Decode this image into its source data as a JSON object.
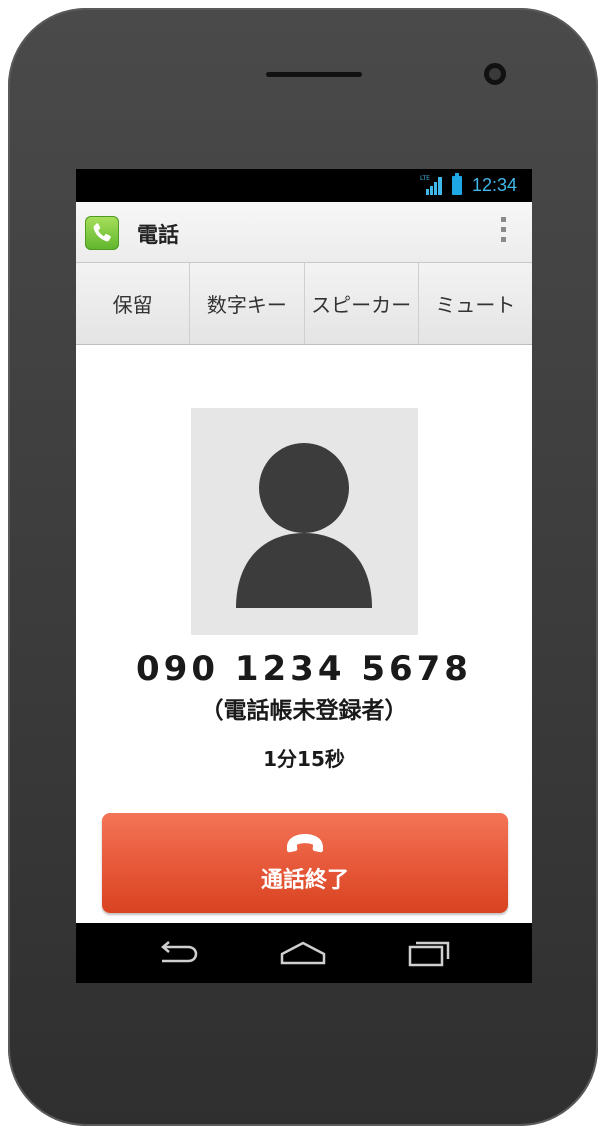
{
  "status_bar": {
    "network_label": "LTE",
    "time": "12:34",
    "signal_icon": "signal-bars-icon",
    "battery_icon": "battery-icon"
  },
  "action_bar": {
    "app_icon": "phone-icon",
    "title": "電話",
    "overflow_icon": "overflow-menu-icon"
  },
  "tabs": [
    {
      "label": "保留"
    },
    {
      "label": "数字キー"
    },
    {
      "label": "スピーカー"
    },
    {
      "label": "ミュート"
    }
  ],
  "call": {
    "avatar_icon": "person-icon",
    "number": "090 1234 5678",
    "contact_note": "（電話帳未登録者）",
    "duration": "1分15秒"
  },
  "end_call_button": {
    "icon": "hang-up-icon",
    "label": "通話終了",
    "color": "#e75a3b"
  },
  "nav_bar": {
    "back_icon": "back-icon",
    "home_icon": "home-icon",
    "recent_icon": "recent-apps-icon"
  },
  "colors": {
    "status_accent": "#40b8ea",
    "app_icon_green": "#5fb52d",
    "device_body": "#3a3a3a"
  }
}
